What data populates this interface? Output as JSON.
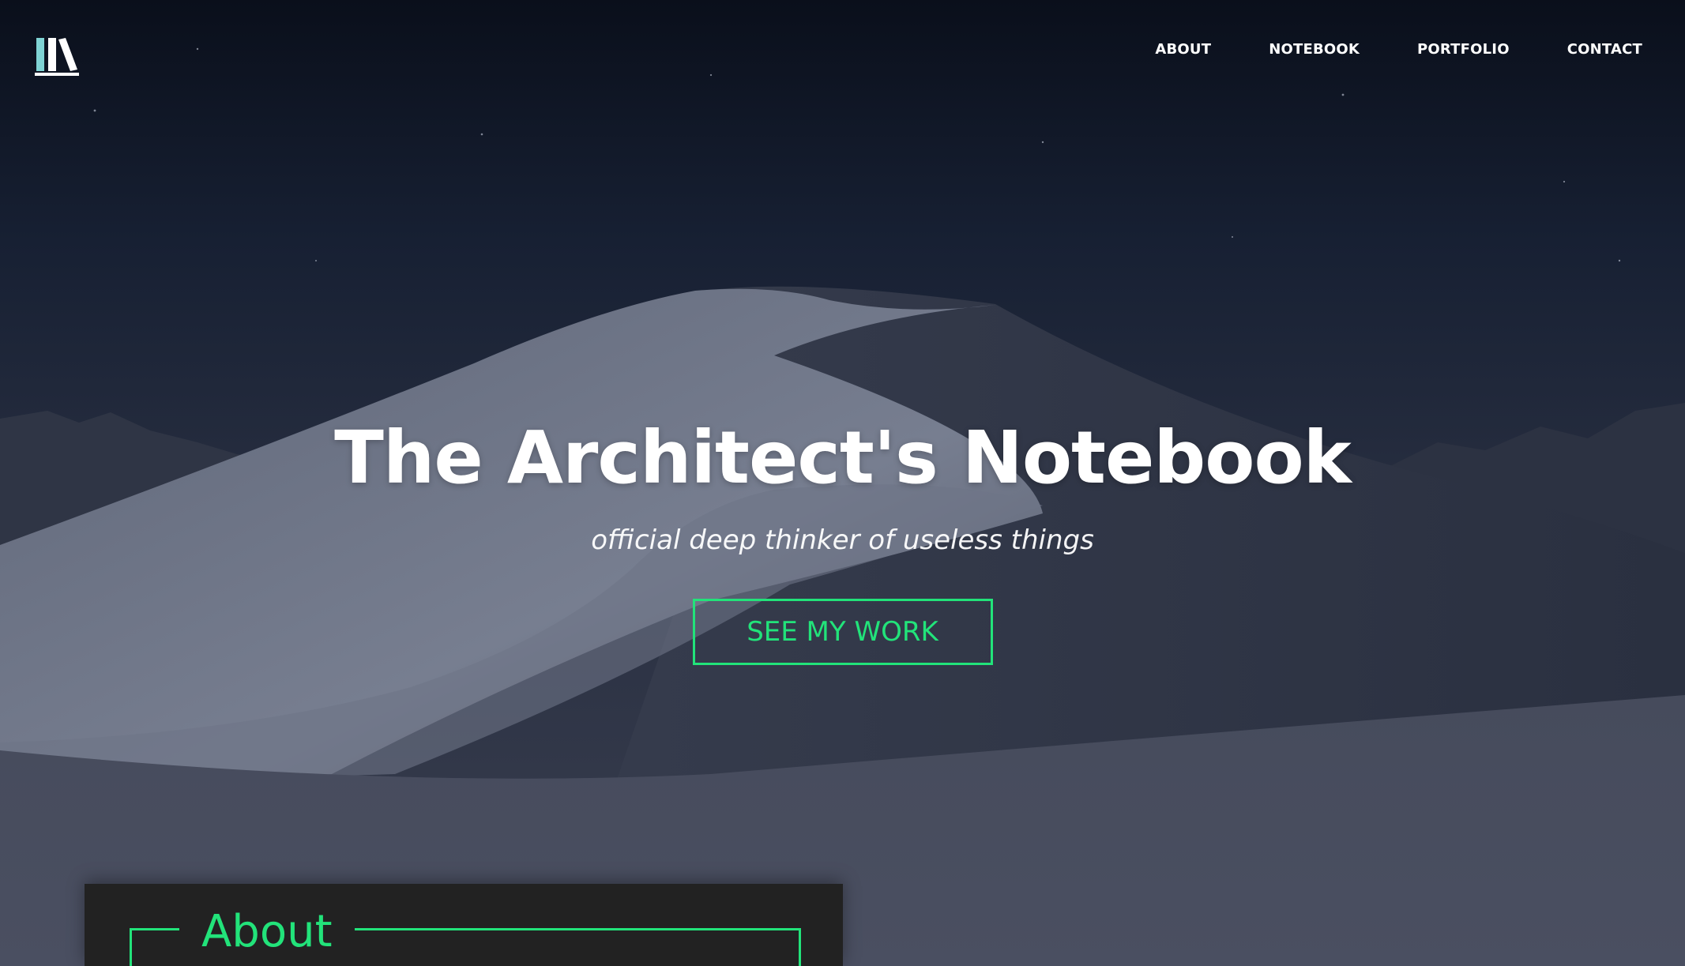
{
  "nav": {
    "logo_icon": "bookshelf-icon",
    "links": [
      "ABOUT",
      "NOTEBOOK",
      "PORTFOLIO",
      "CONTACT"
    ]
  },
  "hero": {
    "title": "The Architect's Notebook",
    "subtitle": "official deep thinker of useless things",
    "cta_label": "SEE MY WORK"
  },
  "about": {
    "heading": "About"
  },
  "colors": {
    "accent": "#22e37a",
    "logo_teal": "#7fd3d4",
    "card_bg": "#222222",
    "sky_top": "#0b111d",
    "dune": "#5c6274"
  }
}
